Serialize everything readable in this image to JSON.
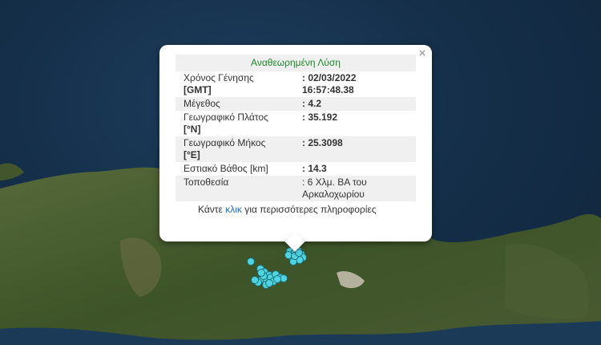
{
  "popup": {
    "title": "Αναθεωρημένη Λύση",
    "close_label": "×",
    "rows": [
      {
        "key_line1": "Χρόνος Γένησης",
        "key_line2": "[GMT]",
        "value_line1": ": 02/03/2022",
        "value_line2": "16:57:48.38"
      },
      {
        "key_line1": "Μέγεθος",
        "key_line2": "",
        "value_line1": ": 4.2",
        "value_line2": ""
      },
      {
        "key_line1": "Γεωγραφικό Πλάτος",
        "key_line2": "[°N]",
        "value_line1": ": 35.192",
        "value_line2": ""
      },
      {
        "key_line1": "Γεωγραφικό Μήκος",
        "key_line2": "[°E]",
        "value_line1": ": 25.3098",
        "value_line2": ""
      },
      {
        "key_line1": "Εστιακό Βάθος [km]",
        "key_line2": "",
        "value_line1": ": 14.3",
        "value_line2": ""
      },
      {
        "key_line1": "Τοποθεσία",
        "key_line2": "",
        "value_line1": ": 6 Χλμ. ΒΑ του",
        "value_line2": "Αρκαλοχωρίου"
      }
    ],
    "more_prefix": "Κάντε ",
    "more_link": "κλικ",
    "more_suffix": " για περισσότερες πληροφορίες"
  },
  "map": {
    "sea_color": "#173553",
    "land_color": "#3e5a2a",
    "marker_color": "#4fd4e0",
    "marker_count": 30
  }
}
